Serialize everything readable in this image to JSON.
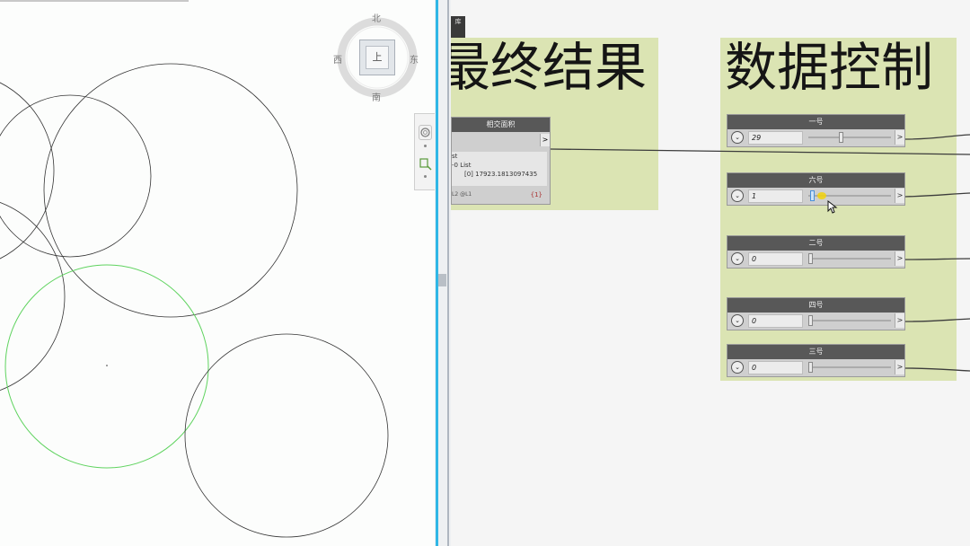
{
  "viewcube": {
    "north": "北",
    "south": "南",
    "east": "东",
    "west": "西",
    "face": "上"
  },
  "side_tab": {
    "label": "库"
  },
  "groups": {
    "result": {
      "title": "最终结果"
    },
    "control": {
      "title": "数据控制"
    }
  },
  "watch_node": {
    "title": "相交面积",
    "output_port": ">",
    "lines": [
      "st",
      "-0 List",
      "[0] 17923.1813097435"
    ],
    "footer_left": "L2 @L1",
    "footer_right": "{1}"
  },
  "sliders": [
    {
      "title": "一号",
      "value": "29",
      "fraction": 0.37,
      "port": ">"
    },
    {
      "title": "六号",
      "value": "1",
      "fraction": 0.02,
      "port": ">"
    },
    {
      "title": "二号",
      "value": "0",
      "fraction": 0.0,
      "port": ">"
    },
    {
      "title": "四号",
      "value": "0",
      "fraction": 0.0,
      "port": ">"
    },
    {
      "title": "三号",
      "value": "0",
      "fraction": 0.0,
      "port": ">"
    }
  ],
  "colors": {
    "group_fill": "#dbe4b3",
    "node_header": "#585858",
    "selected_circle": "#5fd35f",
    "splitter_accent": "#30b7e6",
    "highlight": "#f2d20a"
  },
  "icons": [
    "orbit-icon",
    "zoom-extents-icon",
    "cursor-icon"
  ]
}
